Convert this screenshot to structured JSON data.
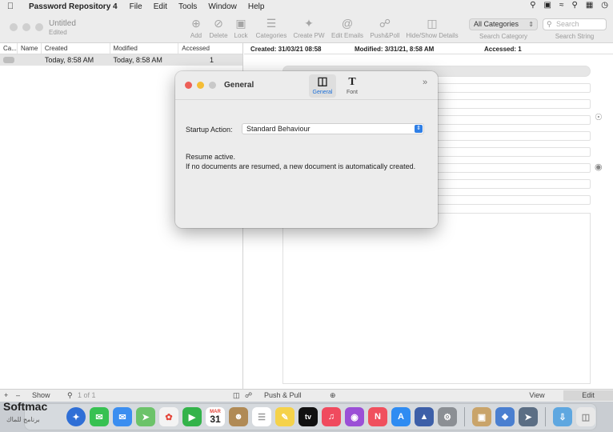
{
  "menubar": {
    "app_name": "Password Repository 4",
    "items": [
      "File",
      "Edit",
      "Tools",
      "Window",
      "Help"
    ]
  },
  "window": {
    "doc_title": "Untitled",
    "doc_status": "Edited"
  },
  "toolbar": {
    "add": "Add",
    "delete": "Delete",
    "lock": "Lock",
    "categories": "Categories",
    "create_pw": "Create PW",
    "edit_emails": "Edit Emails",
    "push_poll": "Push&Poll",
    "hide_show": "Hide/Show Details",
    "category_value": "All Categories",
    "category_label": "Search Category",
    "search_placeholder": "Search",
    "search_label": "Search String"
  },
  "list": {
    "columns": [
      "Ca...",
      "Name",
      "Created",
      "Modified",
      "Accessed"
    ],
    "rows": [
      {
        "created": "Today, 8:58 AM",
        "modified": "Today, 8:58 AM",
        "accessed": "1"
      }
    ]
  },
  "details": {
    "created": "Created: 31/03/21 08:58",
    "modified": "Modified: 3/31/21, 8:58 AM",
    "accessed": "Accessed: 1"
  },
  "bottombar": {
    "plus": "+",
    "minus": "–",
    "show": "Show",
    "page_count": "1 of 1",
    "push_pull": "Push & Pull",
    "view": "View",
    "edit": "Edit"
  },
  "dialog": {
    "title": "General",
    "tab_general": "General",
    "tab_font": "Font",
    "startup_label": "Startup Action:",
    "startup_value": "Standard Behaviour",
    "info_line1": "Resume active.",
    "info_line2": "If no documents are resumed, a new document is automatically created.",
    "colors": {
      "close": "#ed5f57",
      "minimize": "#f5bd36",
      "zoom": "#c8c8c8"
    }
  },
  "dock": {
    "calendar_month": "MAR",
    "calendar_day": "31",
    "tv_label": "tv"
  },
  "watermark": {
    "text": "Softmac",
    "subtext": "برنامج للماك"
  }
}
